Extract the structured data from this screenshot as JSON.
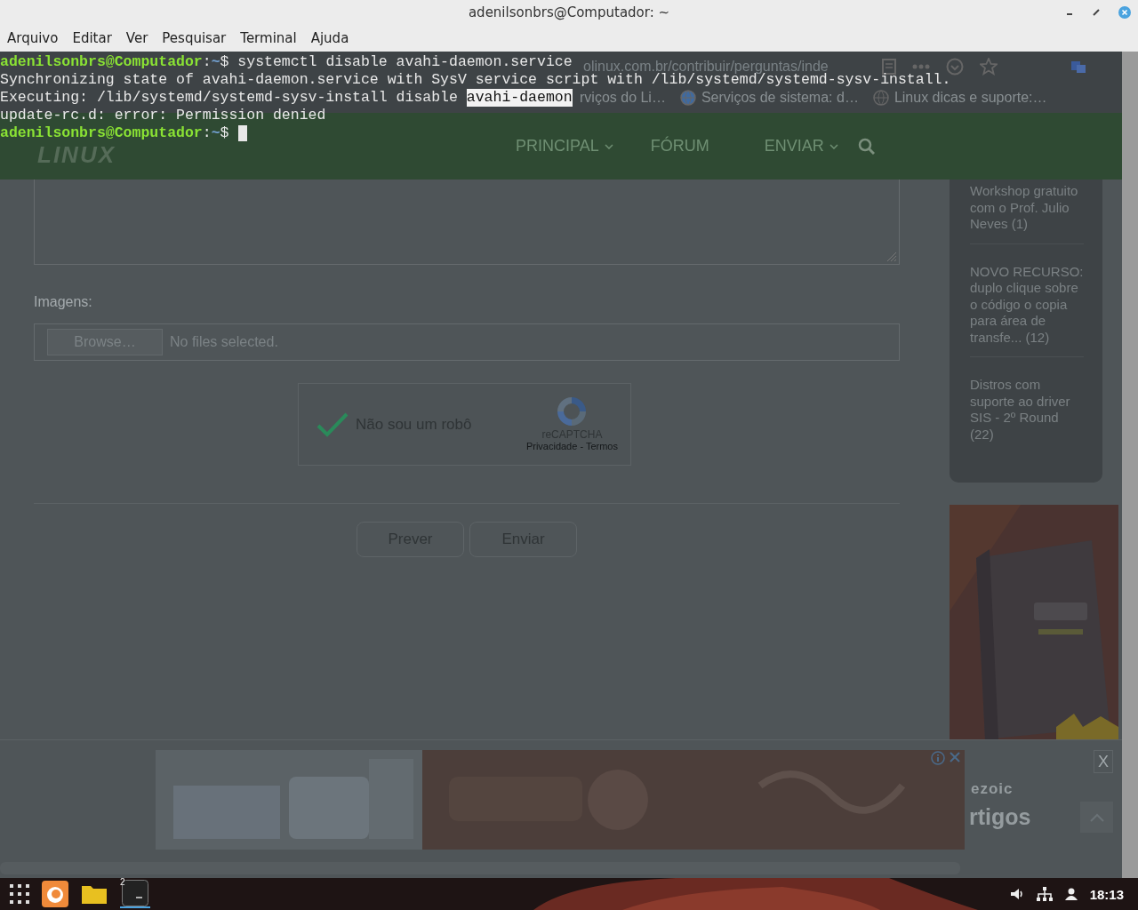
{
  "window": {
    "title": "adenilsonbrs@Computador: ~"
  },
  "menu": [
    "Arquivo",
    "Editar",
    "Ver",
    "Pesquisar",
    "Terminal",
    "Ajuda"
  ],
  "terminal": {
    "lines": [
      {
        "kind": "prompt",
        "user": "adenilsonbrs@Computador",
        "separator": ":",
        "path": "~",
        "symbol": "$",
        "command": " systemctl disable avahi-daemon.service"
      },
      {
        "kind": "output",
        "text": "Synchronizing state of avahi-daemon.service with SysV service script with /lib/systemd/systemd-sysv-install."
      },
      {
        "kind": "output",
        "text": "Executing: /lib/systemd/systemd-sysv-install disable ",
        "selection": "avahi-daemon"
      },
      {
        "kind": "output",
        "text": "update-rc.d: error: Permission denied"
      },
      {
        "kind": "prompt",
        "user": "adenilsonbrs@Computador",
        "separator": ":",
        "path": "~",
        "symbol": "$",
        "cursor": true
      }
    ]
  },
  "browser": {
    "url": "olinux.com.br/contribuir/perguntas/inde",
    "bookmarks": [
      "rviços do Li…",
      "Serviços de sistema: d…",
      "Linux dicas e suporte:…"
    ],
    "logo": "LINUX",
    "nav": [
      {
        "label": "PRINCIPAL",
        "dropdown": true
      },
      {
        "label": "FÓRUM",
        "dropdown": false
      },
      {
        "label": "ENVIAR",
        "dropdown": true
      }
    ],
    "images_label": "Imagens:",
    "browse": "Browse…",
    "no_files": "No files selected.",
    "captcha": {
      "checked": true,
      "label": "Não sou um robô",
      "brand": "reCAPTCHA",
      "links": "Privacidade - Termos"
    },
    "buttons": [
      "Prever",
      "Enviar"
    ],
    "sidebar": [
      "Workshop gratuito com o Prof. Julio Neves (1)",
      "NOVO RECURSO: duplo clique sobre o código o copia para área de transfe... (12)",
      "Distros com suporte ao driver SIS - 2º Round (22)"
    ],
    "ad_close": "X",
    "ad_brand": "ezoic",
    "ad_heading": "rtigos"
  },
  "taskbar": {
    "badge": "2",
    "clock": "18:13"
  }
}
